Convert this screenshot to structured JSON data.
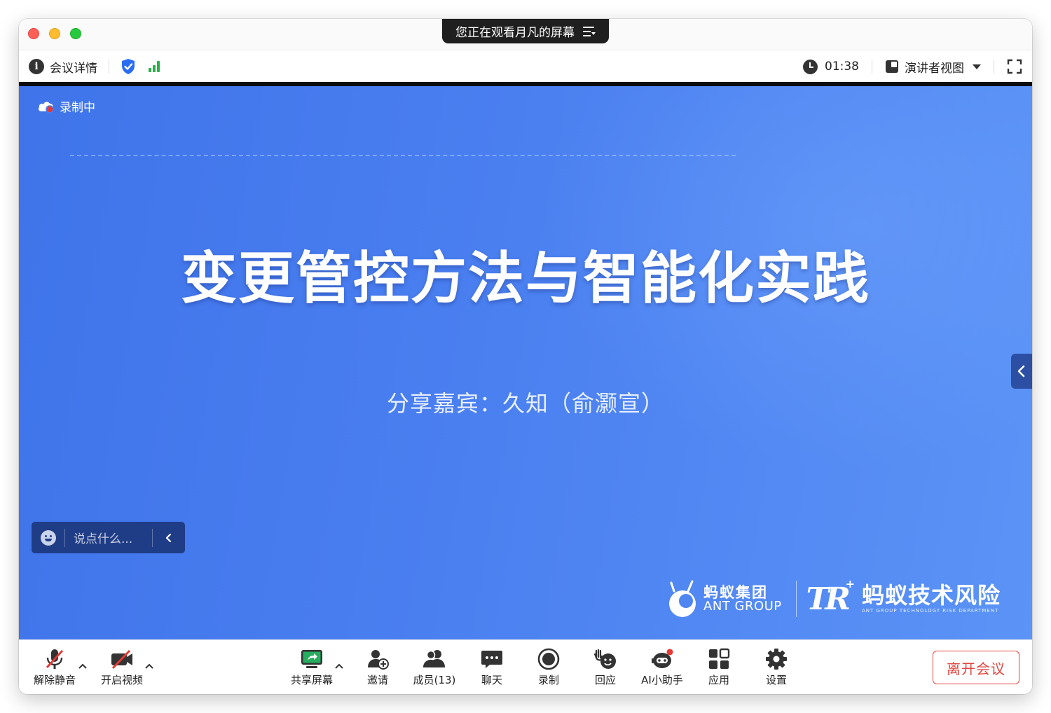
{
  "window": {
    "share_banner": "您正在观看月凡的屏幕"
  },
  "infobar": {
    "meeting_details": "会议详情",
    "timer": "01:38",
    "view_mode": "演讲者视图"
  },
  "slide": {
    "recording_label": "录制中",
    "title": "变更管控方法与智能化实践",
    "subtitle": "分享嘉宾：久知（俞灏宣）",
    "chat_placeholder": "说点什么...",
    "logo_ant_cn": "蚂蚁集团",
    "logo_ant_en": "ANT GROUP",
    "logo_tr_mark": "TR",
    "logo_tr_cn": "蚂蚁技术风险",
    "logo_tr_en": "ANT GROUP TECHNOLOGY RISK DEPARTMENT"
  },
  "toolbar": {
    "unmute": "解除静音",
    "start_video": "开启视频",
    "share_screen": "共享屏幕",
    "invite": "邀请",
    "members": "成员(13)",
    "chat": "聊天",
    "record": "录制",
    "react": "回应",
    "ai_assistant": "AI小助手",
    "apps": "应用",
    "settings": "设置",
    "leave": "离开会议"
  },
  "colors": {
    "slide_blue": "#4a7ff0",
    "leave_red": "#e0463f",
    "signal_green": "#2ab24a",
    "security_blue": "#2a6df4",
    "share_green": "#27ad5f"
  }
}
